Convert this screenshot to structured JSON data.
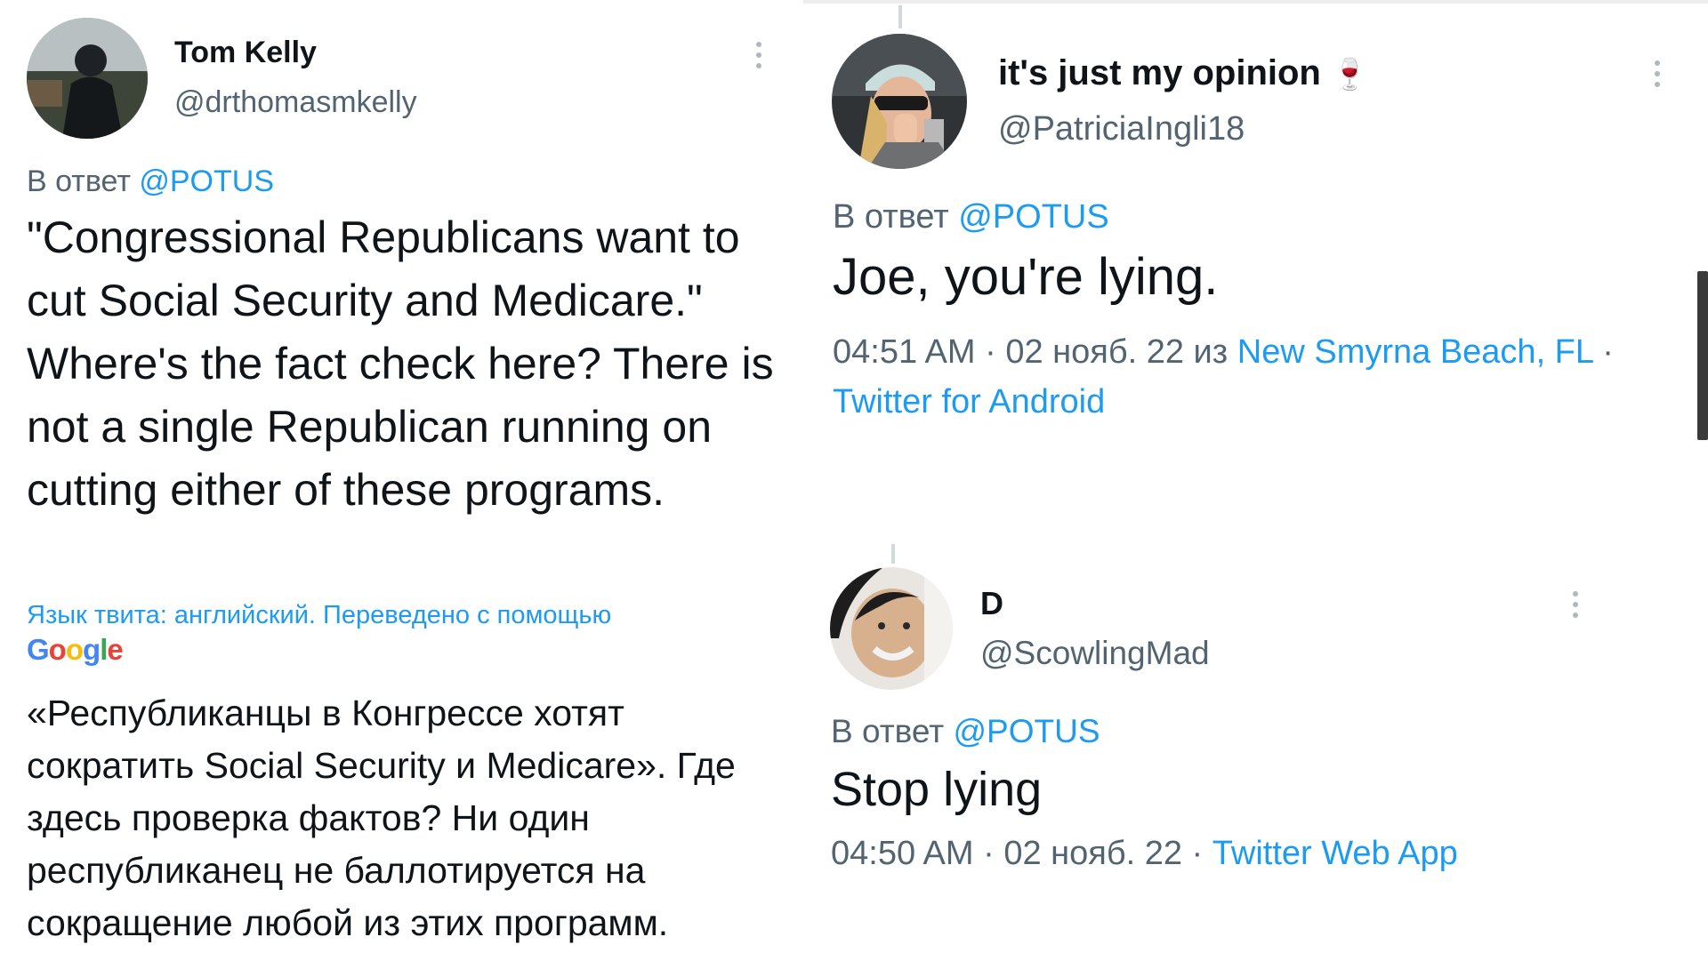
{
  "tweet1": {
    "name": "Tom Kelly",
    "handle": "@drthomasmkelly",
    "reply_prefix": "В ответ",
    "reply_to": "@POTUS",
    "text": "\"Congressional Republicans want to cut Social Security and Medicare.\" Where's the fact check here? There is not a single Republican running on cutting either of these programs.",
    "translation_note": "Язык твита: английский. Переведено с помощью",
    "translation_logo": [
      "G",
      "o",
      "o",
      "g",
      "l",
      "e"
    ],
    "translation_text": "«Республиканцы в Конгрессе хотят сократить Social Security и Medicare». Где здесь проверка фактов? Ни один республиканец не баллотируется на сокращение любой из этих программ."
  },
  "tweet2": {
    "name": "it's just my opinion",
    "name_emoji": "🍷",
    "handle": "@PatriciaIngli18",
    "reply_prefix": "В ответ",
    "reply_to": "@POTUS",
    "text": "Joe, you're lying.",
    "time": "04:51 AM · 02 нояб. 22 из",
    "location": "New Smyrna Beach, FL",
    "sep": "·",
    "source": "Twitter for Android"
  },
  "tweet3": {
    "name": "D",
    "handle": "@ScowlingMad",
    "reply_prefix": "В ответ",
    "reply_to": "@POTUS",
    "text": "Stop lying",
    "time": "04:50 AM · 02 нояб. 22 ·",
    "source": "Twitter Web App"
  },
  "colors": {
    "link": "#1d9bf0",
    "muted": "#536471",
    "text": "#0f1419",
    "google": [
      "#4285f4",
      "#ea4335",
      "#fbbc05",
      "#4285f4",
      "#34a853",
      "#ea4335"
    ]
  },
  "icons": [
    "more-vertical-icon",
    "avatar-photo",
    "wine-glass-emoji",
    "scrollbar"
  ]
}
